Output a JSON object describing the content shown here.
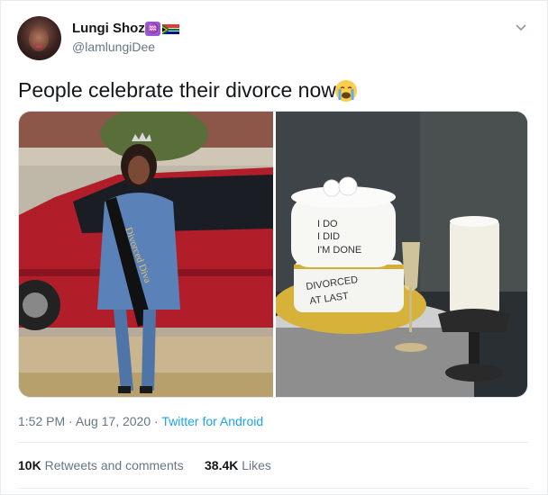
{
  "user": {
    "display_name": "Lungi Shozi",
    "handle": "@lamlungiDee",
    "zodiac_emoji_icon": "aquarius-emoji-icon",
    "flag_emoji_icon": "south-africa-flag-icon"
  },
  "tweet": {
    "text": "People celebrate their divorce now",
    "emoji_icon": "loudly-crying-face-icon",
    "images": [
      {
        "description_icon": "photo-woman-sash-red-car",
        "sash_text": "Divorced Diva"
      },
      {
        "description_icon": "photo-divorce-cake",
        "cake_top_text": [
          "I DO",
          "I DID",
          "I'M DONE"
        ],
        "cake_bottom_text": [
          "DIVORCED",
          "AT LAST"
        ]
      }
    ]
  },
  "meta": {
    "time": "1:52 PM",
    "separator": "·",
    "date": "Aug 17, 2020",
    "source": "Twitter for Android"
  },
  "stats": {
    "retweets_count": "10K",
    "retweets_label": "Retweets and comments",
    "likes_count": "38.4K",
    "likes_label": "Likes"
  },
  "colors": {
    "link_blue": "#1da1f2",
    "secondary_text": "#657786",
    "primary_text": "#14171a"
  }
}
